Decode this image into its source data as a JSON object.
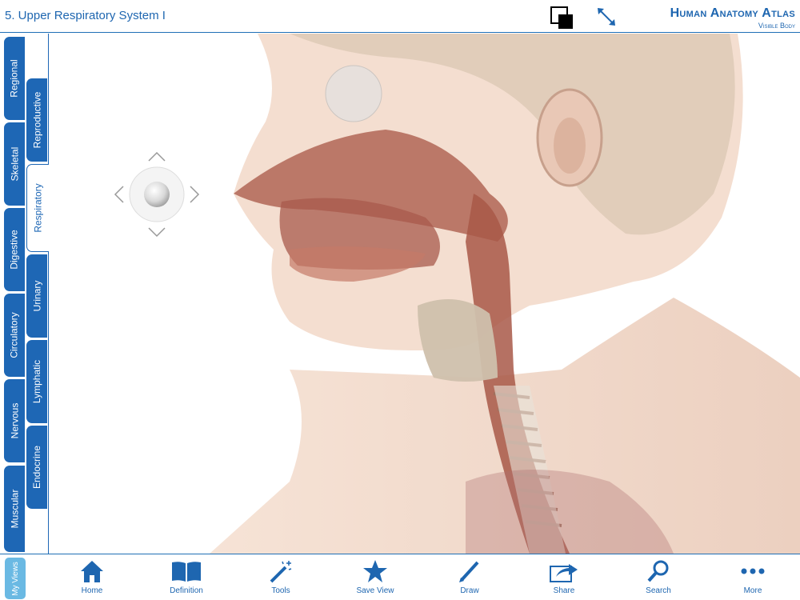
{
  "header": {
    "title": "5. Upper Respiratory System I",
    "brand_main": "Human Anatomy Atlas",
    "brand_sub": "Visible Body"
  },
  "sidebar": {
    "outer_tabs": [
      {
        "label": "Regional",
        "icon": "tab"
      },
      {
        "label": "Skeletal",
        "icon": "tab"
      },
      {
        "label": "Digestive",
        "icon": "tab"
      },
      {
        "label": "Circulatory",
        "icon": "tab"
      },
      {
        "label": "Nervous",
        "icon": "tab"
      },
      {
        "label": "Muscular",
        "icon": "tab"
      }
    ],
    "inner_tabs": [
      {
        "label": "Reproductive"
      },
      {
        "label": "Respiratory",
        "active": true
      },
      {
        "label": "Urinary"
      },
      {
        "label": "Lymphatic"
      },
      {
        "label": "Endocrine"
      }
    ]
  },
  "toolbar": {
    "my_views": "My Views",
    "items": [
      {
        "label": "Home",
        "icon": "home-icon"
      },
      {
        "label": "Definition",
        "icon": "book-icon"
      },
      {
        "label": "Tools",
        "icon": "magic-wand-icon"
      },
      {
        "label": "Save View",
        "icon": "star-icon"
      },
      {
        "label": "Draw",
        "icon": "pencil-icon"
      },
      {
        "label": "Share",
        "icon": "share-icon"
      },
      {
        "label": "Search",
        "icon": "search-icon"
      },
      {
        "label": "More",
        "icon": "more-icon"
      }
    ]
  },
  "colors": {
    "accent": "#1e67b5",
    "my_views": "#6ab9e3",
    "skin": "#f1d8c8",
    "tissue": "#a55a4c"
  }
}
